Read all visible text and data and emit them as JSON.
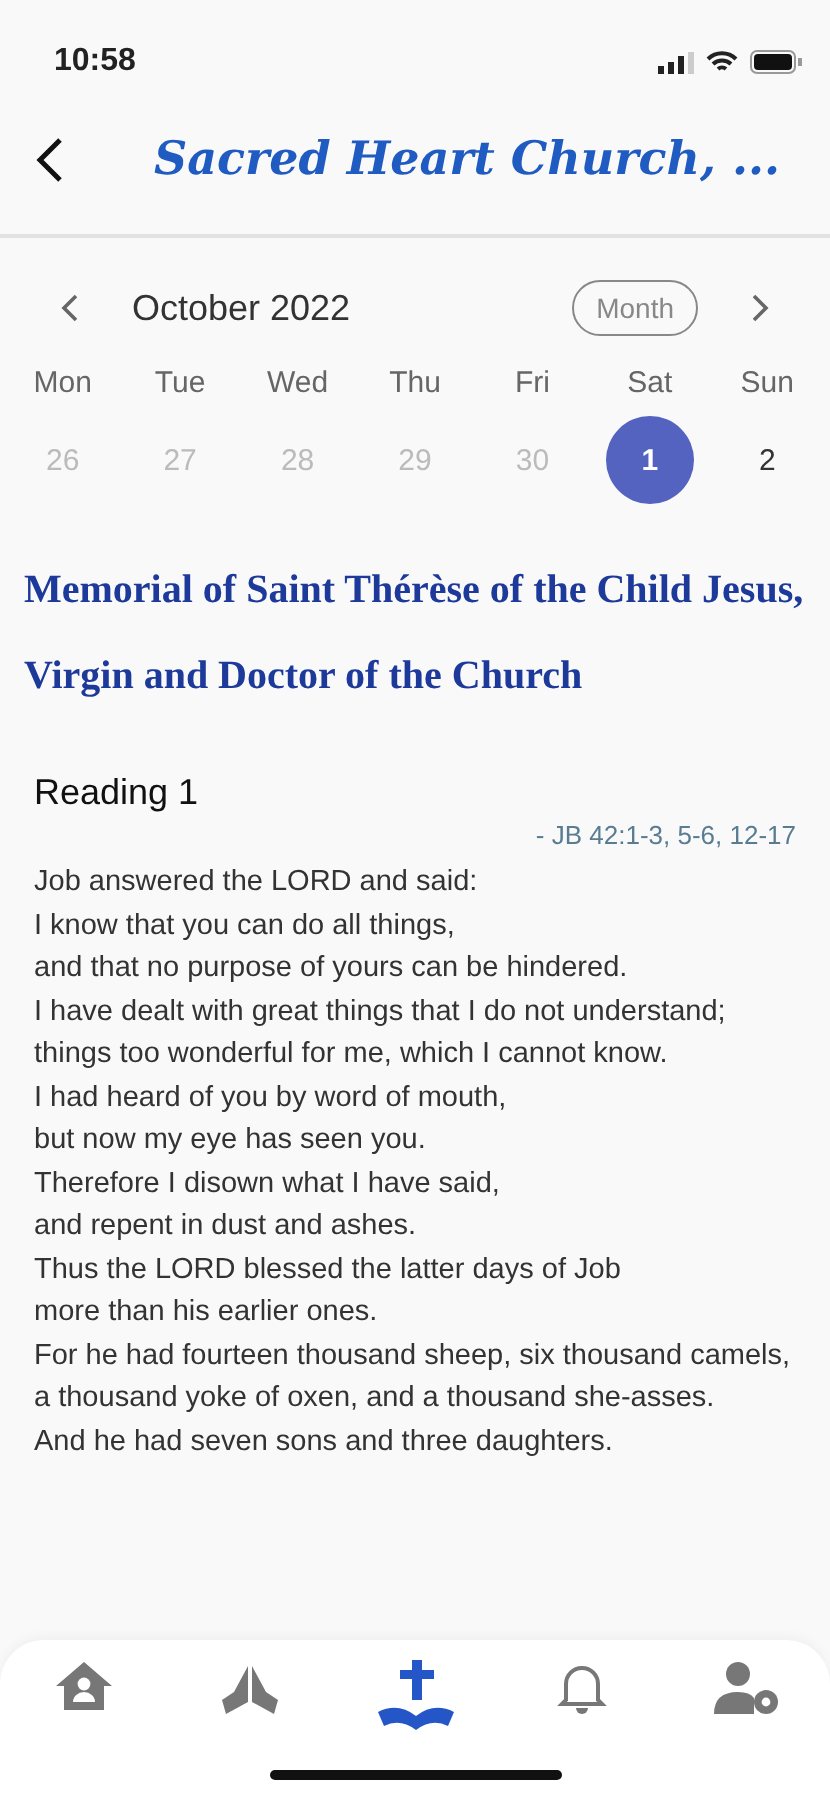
{
  "status_bar": {
    "time": "10:58"
  },
  "header": {
    "title": "Sacred Heart Church, ..."
  },
  "calendar": {
    "month": "October 2022",
    "view_button": "Month",
    "weekdays": [
      "Mon",
      "Tue",
      "Wed",
      "Thu",
      "Fri",
      "Sat",
      "Sun"
    ],
    "days": [
      {
        "label": "26",
        "muted": true,
        "selected": false
      },
      {
        "label": "27",
        "muted": true,
        "selected": false
      },
      {
        "label": "28",
        "muted": true,
        "selected": false
      },
      {
        "label": "29",
        "muted": true,
        "selected": false
      },
      {
        "label": "30",
        "muted": true,
        "selected": false
      },
      {
        "label": "1",
        "muted": false,
        "selected": true
      },
      {
        "label": "2",
        "muted": false,
        "selected": false
      }
    ]
  },
  "feast": {
    "title": "Memorial of Saint Thérèse of the Child Jesus, Virgin and Doctor of the Church"
  },
  "reading": {
    "heading": "Reading 1",
    "reference": "- JB 42:1-3, 5-6, 12-17",
    "lines": [
      "Job answered the LORD and said:",
      "I know that you can do all things,",
      "and that no purpose of yours can be hindered.",
      "I have dealt with great things that I do not understand;",
      "things too wonderful for me, which I cannot know.",
      "I had heard of you by word of mouth,",
      "but now my eye has seen you.",
      "Therefore I disown what I have said,",
      "and repent in dust and ashes.",
      "Thus the LORD blessed the latter days of Job",
      "more than his earlier ones.",
      "For he had fourteen thousand sheep, six thousand camels,",
      "a thousand yoke of oxen, and a thousand she-asses.",
      "And he had seven sons and three daughters."
    ]
  },
  "tabs": [
    {
      "kind": "home",
      "selected": false
    },
    {
      "kind": "prayer",
      "selected": false
    },
    {
      "kind": "readings",
      "selected": true
    },
    {
      "kind": "notifications",
      "selected": false
    },
    {
      "kind": "account",
      "selected": false
    }
  ]
}
